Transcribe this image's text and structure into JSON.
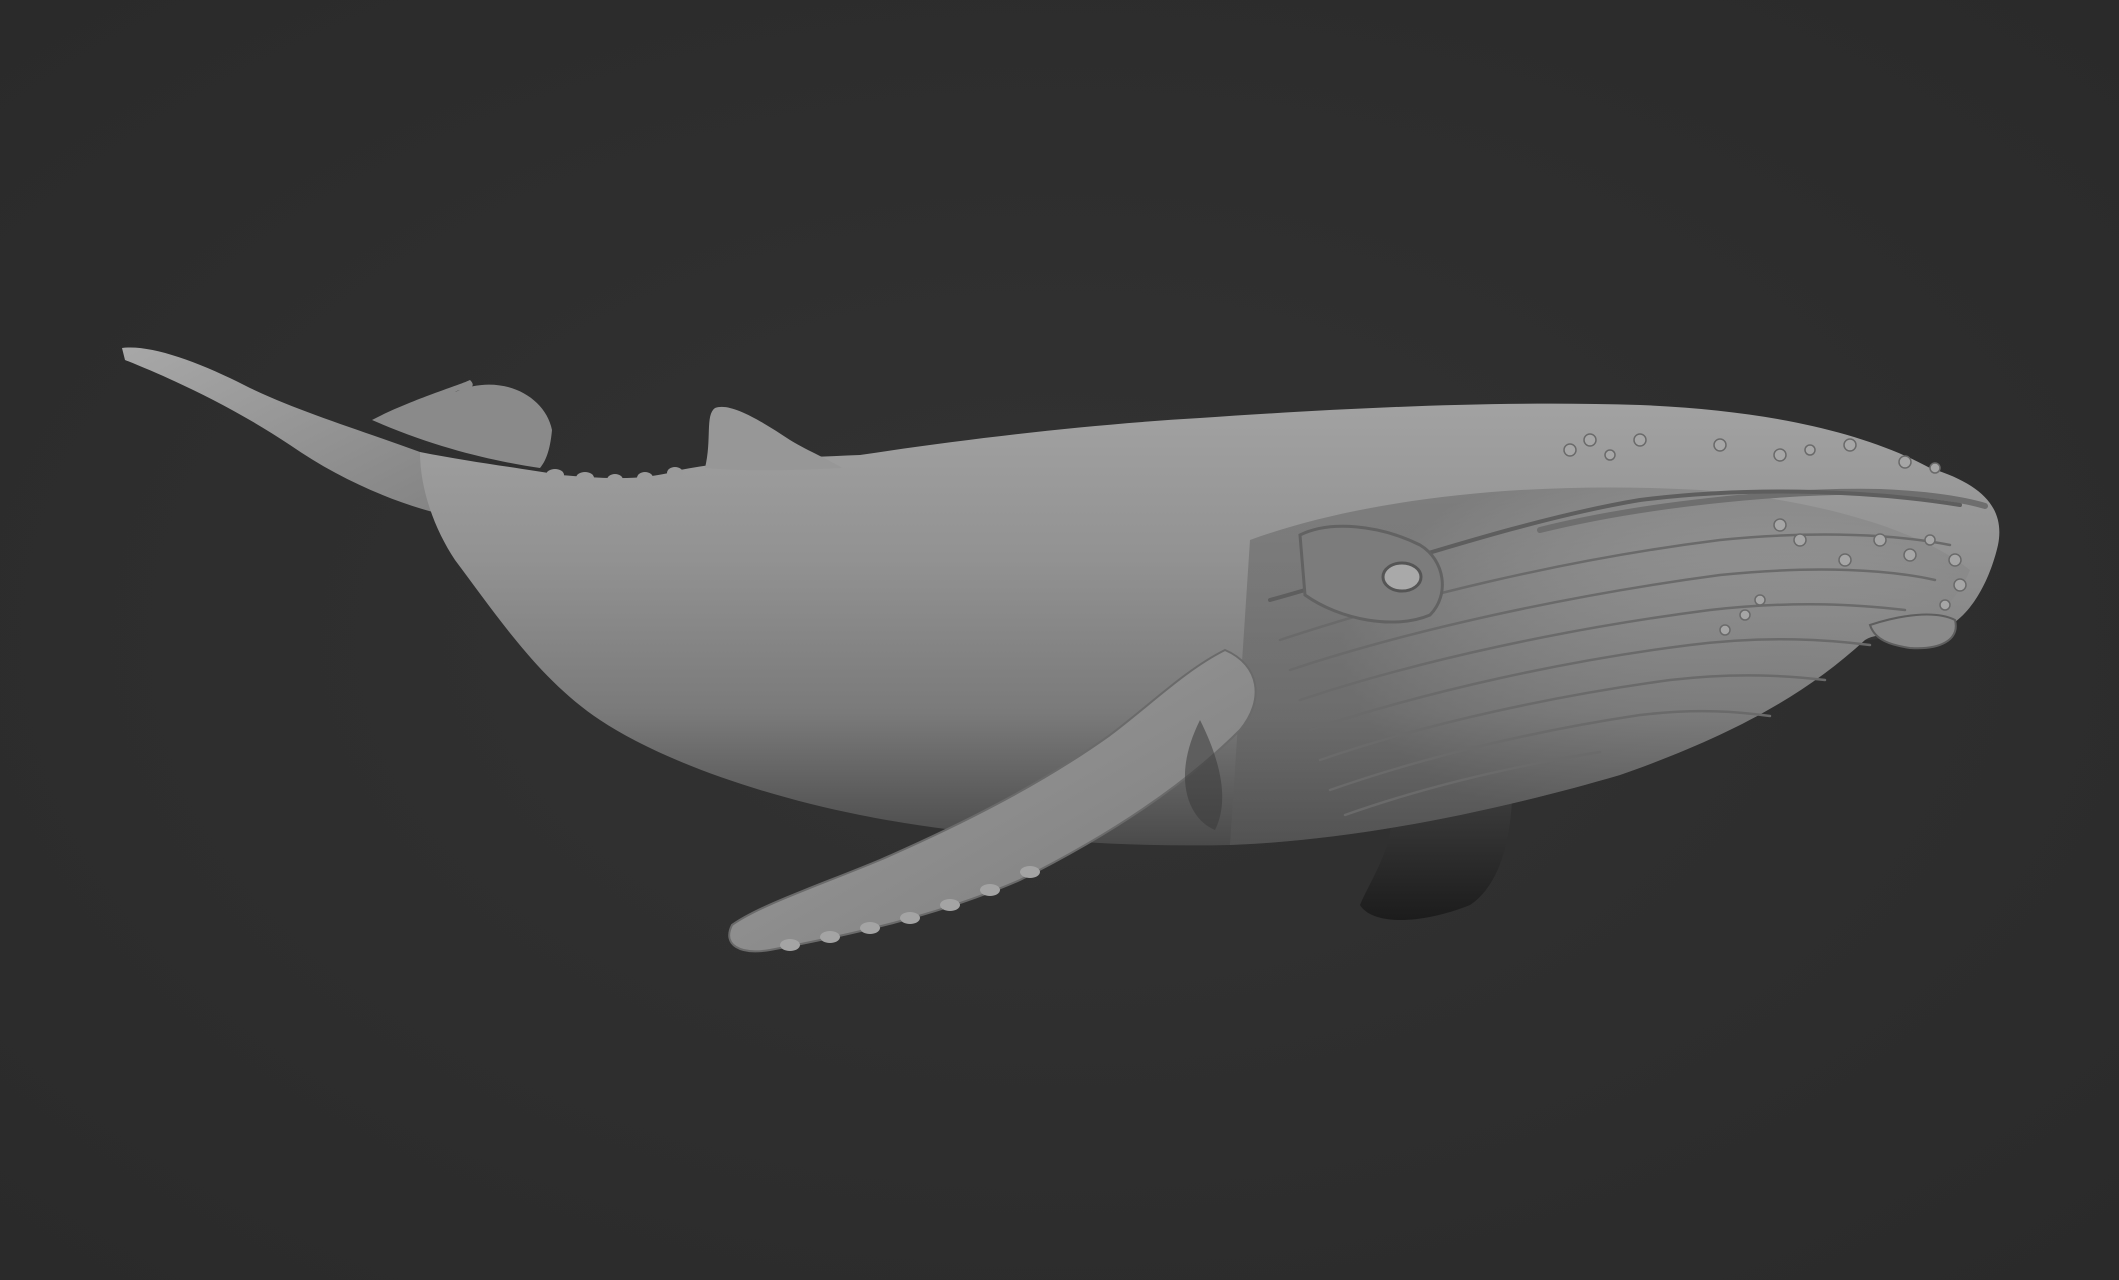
{
  "scene": {
    "background_color": "#2e2e2e",
    "subject": "humpback-whale",
    "material_color": "#8c8c8c",
    "render_style": "clay"
  }
}
